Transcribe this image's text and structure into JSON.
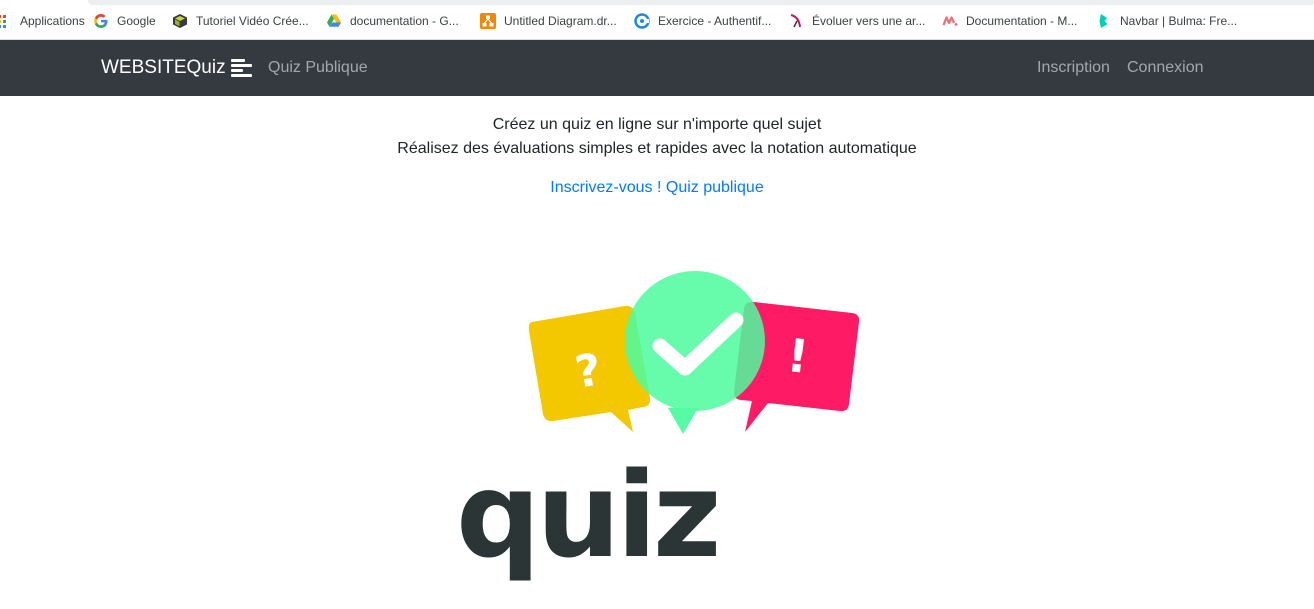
{
  "bookmarks": [
    {
      "label": "Applications",
      "icon": "apps-grid-icon"
    },
    {
      "label": "Google",
      "icon": "google-icon"
    },
    {
      "label": "Tutoriel Vidéo Crée...",
      "icon": "tutorial-cube-icon"
    },
    {
      "label": "documentation - G...",
      "icon": "google-drive-icon"
    },
    {
      "label": "Untitled Diagram.dr...",
      "icon": "drawio-icon"
    },
    {
      "label": "Exercice - Authentif...",
      "icon": "exercise-c-icon"
    },
    {
      "label": "Évoluer vers une ar...",
      "icon": "evoluer-icon"
    },
    {
      "label": "Documentation - M...",
      "icon": "materialize-icon"
    },
    {
      "label": "Navbar | Bulma: Fre...",
      "icon": "bulma-icon"
    }
  ],
  "navbar": {
    "brand": "WEBSITEQuiz",
    "brand_icon": "align-left-icon",
    "quiz_publique": "Quiz Publique",
    "inscription": "Inscription",
    "connexion": "Connexion"
  },
  "hero": {
    "line1": "Créez un quiz en ligne sur n'importe quel sujet",
    "line2": "Réalisez des évaluations simples et rapides avec la notation automatique",
    "cta_inscrivez": "Inscrivez-vous !",
    "cta_quiz": "Quiz publique"
  },
  "logo": {
    "question_mark": "?",
    "exclamation_mark": "!",
    "word": "quiz",
    "colors": {
      "yellow": "#f3c800",
      "green": "#4dfc9f",
      "pink": "#ff1a66",
      "dark": "#2b3536"
    }
  },
  "colors": {
    "navbar_bg": "#343a40",
    "link": "#007bff"
  }
}
